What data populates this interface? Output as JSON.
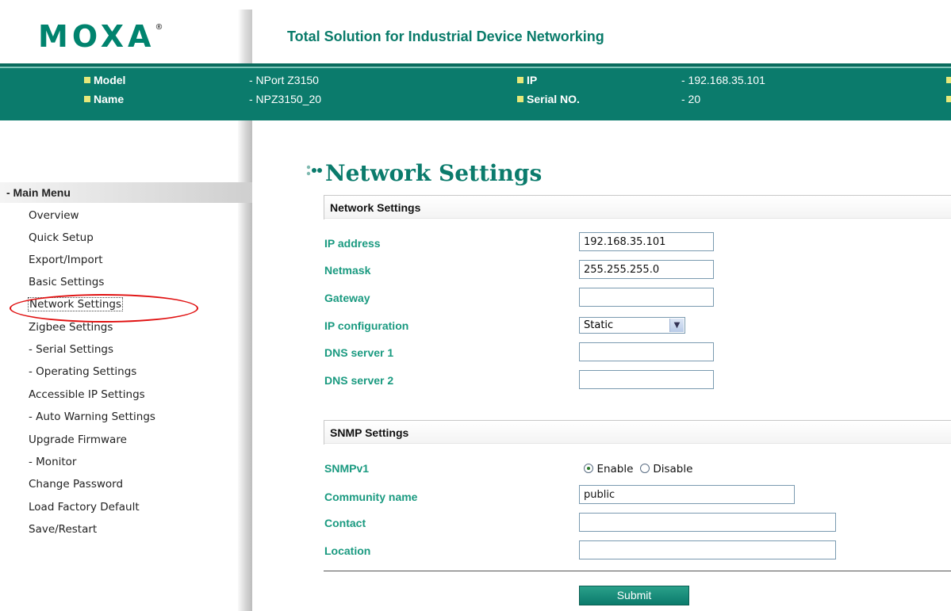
{
  "header": {
    "logo_text": "MOXA",
    "logo_mark": "®",
    "tagline": "Total Solution for Industrial Device Networking"
  },
  "info": {
    "model_label": "Model",
    "model_value": "- NPort Z3150",
    "name_label": "Name",
    "name_value": "- NPZ3150_20",
    "ip_label": "IP",
    "ip_value": "- 192.168.35.101",
    "serial_label": "Serial NO.",
    "serial_value": "- 20"
  },
  "sidebar": {
    "main_menu": "- Main Menu",
    "items": [
      {
        "label": "Overview"
      },
      {
        "label": "Quick Setup"
      },
      {
        "label": "Export/Import"
      },
      {
        "label": "Basic Settings"
      },
      {
        "label": "Network Settings"
      },
      {
        "label": "Zigbee Settings"
      },
      {
        "label": "- Serial Settings"
      },
      {
        "label": "- Operating Settings"
      },
      {
        "label": "Accessible IP Settings"
      },
      {
        "label": "- Auto Warning Settings"
      },
      {
        "label": "Upgrade Firmware"
      },
      {
        "label": "- Monitor"
      },
      {
        "label": "Change Password"
      },
      {
        "label": "Load Factory Default"
      },
      {
        "label": "Save/Restart"
      }
    ]
  },
  "main": {
    "page_title": "Network Settings",
    "network_section": "Network Settings",
    "fields": {
      "ip_address": {
        "label": "IP address",
        "value": "192.168.35.101"
      },
      "netmask": {
        "label": "Netmask",
        "value": "255.255.255.0"
      },
      "gateway": {
        "label": "Gateway",
        "value": ""
      },
      "ip_configuration": {
        "label": "IP configuration",
        "value": "Static"
      },
      "dns1": {
        "label": "DNS server 1",
        "value": ""
      },
      "dns2": {
        "label": "DNS server 2",
        "value": ""
      }
    },
    "snmp_section": "SNMP Settings",
    "snmp": {
      "snmpv1_label": "SNMPv1",
      "enable_label": "Enable",
      "disable_label": "Disable",
      "selected": "Enable",
      "community": {
        "label": "Community name",
        "value": "public"
      },
      "contact": {
        "label": "Contact",
        "value": ""
      },
      "location": {
        "label": "Location",
        "value": ""
      }
    },
    "submit_label": "Submit"
  },
  "colors": {
    "brand_green": "#0b7b6c",
    "label_green": "#1a9a80",
    "bullet_yellow": "#e6e87a",
    "highlight_red": "#e01010"
  }
}
